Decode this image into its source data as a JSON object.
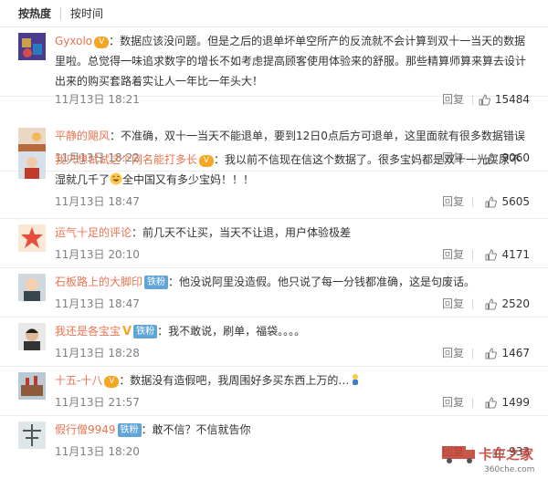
{
  "tabs": {
    "hot": "按热度",
    "time": "按时间"
  },
  "comments": [
    {
      "user": "Gyxolo",
      "text": "：数据应该没问题。但是之后的退单坏单空所产的反流就不会计算到双十一当天的数据里啦。总觉得一味追求数字的增长不如考虑提高顾客使用体验来的舒服。那些精算师算来算去设计出来的购买套路着实让人一年比一年头大！",
      "time": "11月13日 18:21",
      "reply": "回复",
      "likes": "15484"
    },
    {
      "user": "平静的飓风",
      "text": "：不准确，双十一当天不能退单，要到12日0点后方可退单，这里面就有很多数据错误",
      "time": "11月13日 18:22",
      "reply": "回复",
      "likes": "9060"
    },
    {
      "user": "我只想试试这个网名能打多长",
      "text": "：我以前不信现在信这个数据了。很多宝妈都是双十一光买尿不湿就几千了",
      "text2": "全中国又有多少宝妈！！！",
      "time": "11月13日 18:47",
      "reply": "回复",
      "likes": "5605"
    },
    {
      "user": "运气十足的评论",
      "text": "：前几天不让买，当天不让退，用户体验极差",
      "time": "11月13日 20:10",
      "reply": "回复",
      "likes": "4171"
    },
    {
      "user": "石板路上的大脚印",
      "badge": "铁粉",
      "text": "：他没说阿里没造假。他只说了每一分钱都准确，这是句废话。",
      "time": "11月13日 18:47",
      "reply": "回复",
      "likes": "2520"
    },
    {
      "user": "我还是各宝宝",
      "badge": "铁粉",
      "text": "：我不敢说，刷单，福袋。。。。",
      "time": "11月13日 18:28",
      "reply": "回复",
      "likes": "1467"
    },
    {
      "user": "十五-十八",
      "text": "：数据没有造假吧，我周围好多买东西上万的…",
      "time": "11月13日 21:57",
      "reply": "回复",
      "likes": "1499"
    },
    {
      "user": "假行僧9949",
      "badge": "铁粉",
      "text": "：敢不信？不信就告你",
      "time": "11月13日 18:20",
      "reply": "回复",
      "likes": "933"
    }
  ],
  "watermark": {
    "brand": "卡车之家",
    "site": "360che.com"
  },
  "colors": {
    "username": "#eb7350",
    "badge": "#5fa5d8",
    "meta": "#808080"
  }
}
